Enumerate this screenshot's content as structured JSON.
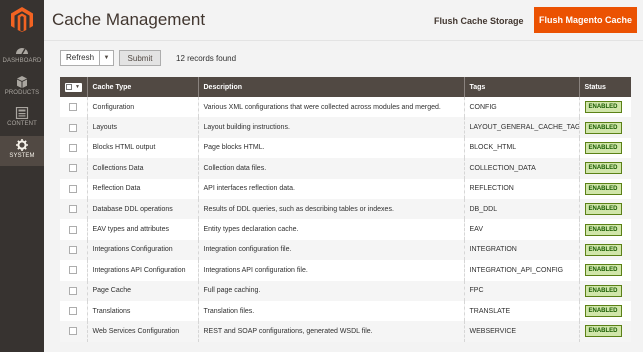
{
  "sidebar": {
    "items": [
      {
        "label": "DASHBOARD"
      },
      {
        "label": "PRODUCTS"
      },
      {
        "label": "CONTENT"
      },
      {
        "label": "SYSTEM"
      }
    ]
  },
  "header": {
    "title": "Cache Management",
    "flush_storage": "Flush Cache Storage",
    "flush_magento": "Flush Magento Cache"
  },
  "toolbar": {
    "action_select": "Refresh",
    "submit": "Submit",
    "records": "12 records found"
  },
  "table": {
    "columns": [
      "Cache Type",
      "Description",
      "Tags",
      "Status"
    ],
    "rows": [
      {
        "type": "Configuration",
        "desc": "Various XML configurations that were collected across modules and merged.",
        "tag": "CONFIG",
        "status": "ENABLED"
      },
      {
        "type": "Layouts",
        "desc": "Layout building instructions.",
        "tag": "LAYOUT_GENERAL_CACHE_TAG",
        "status": "ENABLED"
      },
      {
        "type": "Blocks HTML output",
        "desc": "Page blocks HTML.",
        "tag": "BLOCK_HTML",
        "status": "ENABLED"
      },
      {
        "type": "Collections Data",
        "desc": "Collection data files.",
        "tag": "COLLECTION_DATA",
        "status": "ENABLED"
      },
      {
        "type": "Reflection Data",
        "desc": "API interfaces reflection data.",
        "tag": "REFLECTION",
        "status": "ENABLED"
      },
      {
        "type": "Database DDL operations",
        "desc": "Results of DDL queries, such as describing tables or indexes.",
        "tag": "DB_DDL",
        "status": "ENABLED"
      },
      {
        "type": "EAV types and attributes",
        "desc": "Entity types declaration cache.",
        "tag": "EAV",
        "status": "ENABLED"
      },
      {
        "type": "Integrations Configuration",
        "desc": "Integration configuration file.",
        "tag": "INTEGRATION",
        "status": "ENABLED"
      },
      {
        "type": "Integrations API Configuration",
        "desc": "Integrations API configuration file.",
        "tag": "INTEGRATION_API_CONFIG",
        "status": "ENABLED"
      },
      {
        "type": "Page Cache",
        "desc": "Full page caching.",
        "tag": "FPC",
        "status": "ENABLED"
      },
      {
        "type": "Translations",
        "desc": "Translation files.",
        "tag": "TRANSLATE",
        "status": "ENABLED"
      },
      {
        "type": "Web Services Configuration",
        "desc": "REST and SOAP configurations, generated WSDL file.",
        "tag": "WEBSERVICE",
        "status": "ENABLED"
      }
    ]
  },
  "colors": {
    "accent": "#eb5202",
    "sidebar": "#373330",
    "table_header": "#514943",
    "enabled_bg": "#d0e5a9"
  }
}
